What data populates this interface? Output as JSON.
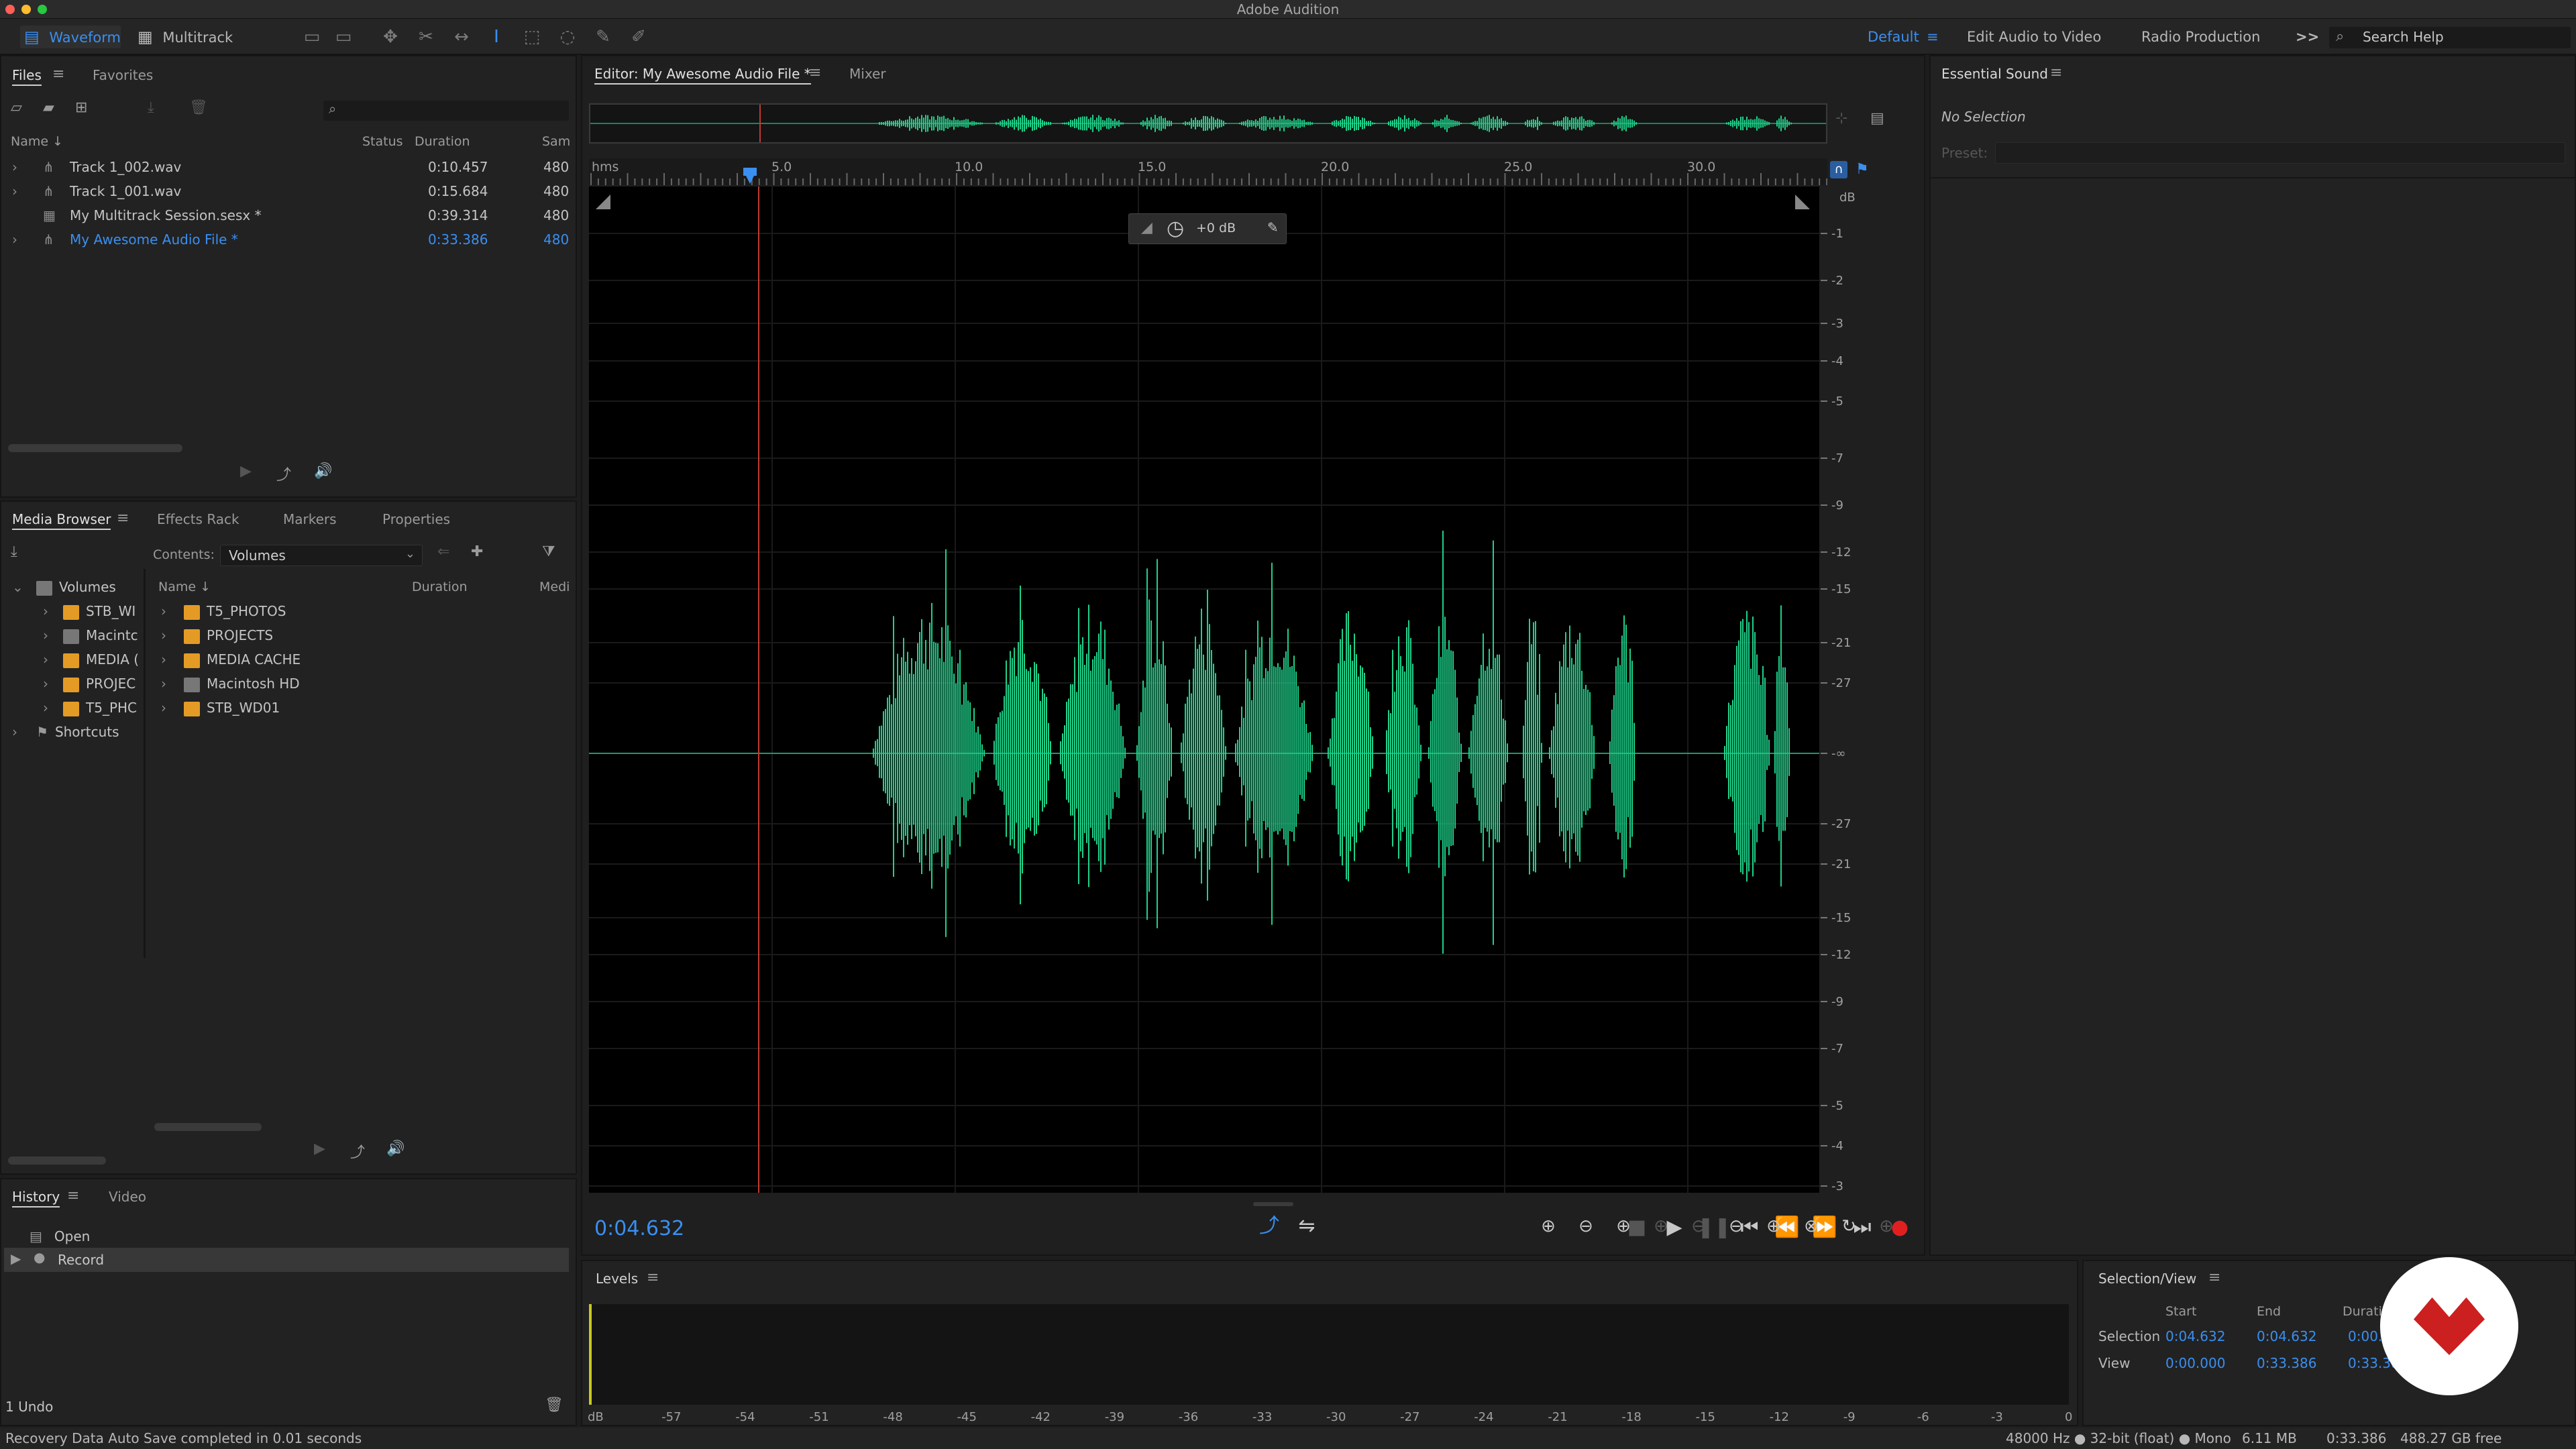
{
  "app": {
    "title": "Adobe Audition"
  },
  "toolbar": {
    "waveform_label": "Waveform",
    "multitrack_label": "Multitrack",
    "workspaces": [
      "Default",
      "Edit Audio to Video",
      "Radio Production"
    ],
    "search_placeholder": "Search Help",
    "more_label": ">>"
  },
  "files_panel": {
    "tabs": [
      "Files",
      "Favorites"
    ],
    "columns": {
      "name": "Name ↓",
      "status": "Status",
      "duration": "Duration",
      "sample": "Sam"
    },
    "rows": [
      {
        "name": "Track 1_002.wav",
        "duration": "0:10.457",
        "sample": "480"
      },
      {
        "name": "Track 1_001.wav",
        "duration": "0:15.684",
        "sample": "480"
      },
      {
        "name": "My Multitrack Session.sesx *",
        "duration": "0:39.314",
        "sample": "480"
      },
      {
        "name": "My Awesome Audio File *",
        "duration": "0:33.386",
        "sample": "480"
      }
    ]
  },
  "media_panel": {
    "tabs": [
      "Media Browser",
      "Effects Rack",
      "Markers",
      "Properties"
    ],
    "contents_label": "Contents:",
    "contents_value": "Volumes",
    "tree": [
      "Volumes",
      "STB_WI",
      "Macintc",
      "MEDIA (",
      "PROJEC",
      "T5_PHC",
      "Shortcuts"
    ],
    "columns": {
      "name": "Name ↓",
      "duration": "Duration",
      "media": "Medi"
    },
    "items": [
      "T5_PHOTOS",
      "PROJECTS",
      "MEDIA CACHE",
      "Macintosh HD",
      "STB_WD01"
    ]
  },
  "history_panel": {
    "tabs": [
      "History",
      "Video"
    ],
    "items": [
      "Open",
      "Record"
    ],
    "undo_label": "1 Undo"
  },
  "editor": {
    "tabs": [
      "Editor: My Awesome Audio File *",
      "Mixer"
    ],
    "ruler_unit": "hms",
    "ruler_ticks": [
      "5.0",
      "10.0",
      "15.0",
      "20.0",
      "25.0",
      "30.0"
    ],
    "db_label": "dB",
    "db_ticks": [
      "-1",
      "-2",
      "-3",
      "-4",
      "-5",
      "-7",
      "-9",
      "-12",
      "-15",
      "-21",
      "-27",
      "-∞",
      "-27",
      "-21",
      "-15",
      "-12",
      "-9",
      "-7",
      "-5",
      "-4",
      "-3",
      "-2",
      "-1"
    ],
    "hud_gain": "+0 dB",
    "current_time": "0:04.632"
  },
  "levels_panel": {
    "title": "Levels",
    "scale": [
      "dB",
      "-57",
      "-54",
      "-51",
      "-48",
      "-45",
      "-42",
      "-39",
      "-36",
      "-33",
      "-30",
      "-27",
      "-24",
      "-21",
      "-18",
      "-15",
      "-12",
      "-9",
      "-6",
      "-3",
      "0"
    ]
  },
  "essential_sound": {
    "title": "Essential Sound",
    "no_selection": "No Selection",
    "preset_label": "Preset:"
  },
  "selection_view": {
    "title": "Selection/View",
    "columns": [
      "Start",
      "End",
      "Durati"
    ],
    "selection_label": "Selection",
    "view_label": "View",
    "selection": [
      "0:04.632",
      "0:04.632",
      "0:00."
    ],
    "view": [
      "0:00.000",
      "0:33.386",
      "0:33.38"
    ]
  },
  "status_bar": {
    "message": "Recovery Data Auto Save completed in 0.01 seconds",
    "format": "48000 Hz ● 32-bit (float) ● Mono",
    "size": "6.11 MB",
    "duration": "0:33.386",
    "free": "488.27 GB free"
  },
  "colors": {
    "waveform": "#1fd18a",
    "accent": "#3a8ff0",
    "playhead": "#c03a30"
  }
}
